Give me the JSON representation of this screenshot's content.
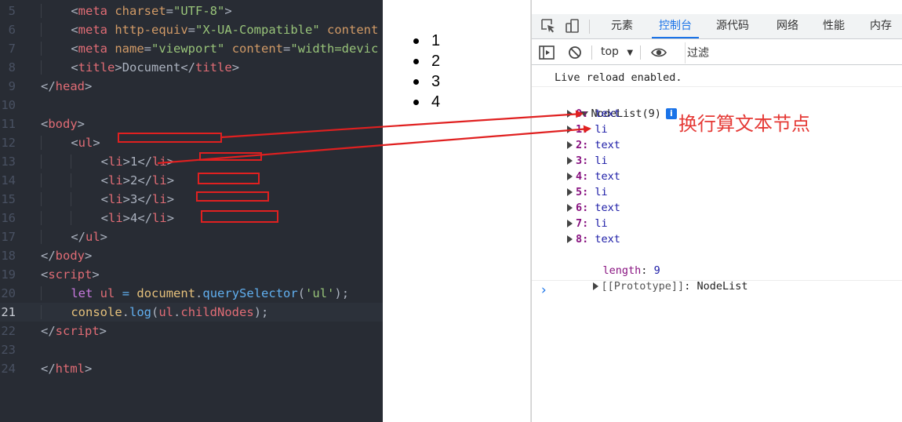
{
  "editor": {
    "lines": [
      {
        "num": "5",
        "indent": 1,
        "tokens": [
          [
            "t-pun",
            "<"
          ],
          [
            "t-tag",
            "meta"
          ],
          [
            "t-txt",
            " "
          ],
          [
            "t-attr",
            "charset"
          ],
          [
            "t-pun",
            "="
          ],
          [
            "t-str",
            "\"UTF-8\""
          ],
          [
            "t-pun",
            ">"
          ]
        ]
      },
      {
        "num": "6",
        "indent": 1,
        "tokens": [
          [
            "t-pun",
            "<"
          ],
          [
            "t-tag",
            "meta"
          ],
          [
            "t-txt",
            " "
          ],
          [
            "t-attr",
            "http-equiv"
          ],
          [
            "t-pun",
            "="
          ],
          [
            "t-str",
            "\"X-UA-Compatible\""
          ],
          [
            "t-txt",
            " "
          ],
          [
            "t-attr",
            "content"
          ]
        ]
      },
      {
        "num": "7",
        "indent": 1,
        "tokens": [
          [
            "t-pun",
            "<"
          ],
          [
            "t-tag",
            "meta"
          ],
          [
            "t-txt",
            " "
          ],
          [
            "t-attr",
            "name"
          ],
          [
            "t-pun",
            "="
          ],
          [
            "t-str",
            "\"viewport\""
          ],
          [
            "t-txt",
            " "
          ],
          [
            "t-attr",
            "content"
          ],
          [
            "t-pun",
            "="
          ],
          [
            "t-str",
            "\"width=devic"
          ]
        ]
      },
      {
        "num": "8",
        "indent": 1,
        "tokens": [
          [
            "t-pun",
            "<"
          ],
          [
            "t-tag",
            "title"
          ],
          [
            "t-pun",
            ">"
          ],
          [
            "t-txt",
            "Document"
          ],
          [
            "t-pun",
            "</"
          ],
          [
            "t-tag",
            "title"
          ],
          [
            "t-pun",
            ">"
          ]
        ]
      },
      {
        "num": "9",
        "indent": 0,
        "tokens": [
          [
            "t-pun",
            "</"
          ],
          [
            "t-tag",
            "head"
          ],
          [
            "t-pun",
            ">"
          ]
        ]
      },
      {
        "num": "10",
        "indent": 0,
        "tokens": []
      },
      {
        "num": "11",
        "indent": 0,
        "tokens": [
          [
            "t-pun",
            "<"
          ],
          [
            "t-tag",
            "body"
          ],
          [
            "t-pun",
            ">"
          ]
        ]
      },
      {
        "num": "12",
        "indent": 1,
        "tokens": [
          [
            "t-pun",
            "<"
          ],
          [
            "t-tag",
            "ul"
          ],
          [
            "t-pun",
            ">"
          ]
        ]
      },
      {
        "num": "13",
        "indent": 2,
        "tokens": [
          [
            "t-pun",
            "<"
          ],
          [
            "t-tag",
            "li"
          ],
          [
            "t-pun",
            ">"
          ],
          [
            "t-txt",
            "1"
          ],
          [
            "t-pun",
            "</"
          ],
          [
            "t-tag",
            "li"
          ],
          [
            "t-pun",
            ">"
          ]
        ]
      },
      {
        "num": "14",
        "indent": 2,
        "tokens": [
          [
            "t-pun",
            "<"
          ],
          [
            "t-tag",
            "li"
          ],
          [
            "t-pun",
            ">"
          ],
          [
            "t-txt",
            "2"
          ],
          [
            "t-pun",
            "</"
          ],
          [
            "t-tag",
            "li"
          ],
          [
            "t-pun",
            ">"
          ]
        ]
      },
      {
        "num": "15",
        "indent": 2,
        "tokens": [
          [
            "t-pun",
            "<"
          ],
          [
            "t-tag",
            "li"
          ],
          [
            "t-pun",
            ">"
          ],
          [
            "t-txt",
            "3"
          ],
          [
            "t-pun",
            "</"
          ],
          [
            "t-tag",
            "li"
          ],
          [
            "t-pun",
            ">"
          ]
        ]
      },
      {
        "num": "16",
        "indent": 2,
        "tokens": [
          [
            "t-pun",
            "<"
          ],
          [
            "t-tag",
            "li"
          ],
          [
            "t-pun",
            ">"
          ],
          [
            "t-txt",
            "4"
          ],
          [
            "t-pun",
            "</"
          ],
          [
            "t-tag",
            "li"
          ],
          [
            "t-pun",
            ">"
          ]
        ]
      },
      {
        "num": "17",
        "indent": 1,
        "tokens": [
          [
            "t-pun",
            "</"
          ],
          [
            "t-tag",
            "ul"
          ],
          [
            "t-pun",
            ">"
          ]
        ]
      },
      {
        "num": "18",
        "indent": 0,
        "tokens": [
          [
            "t-pun",
            "</"
          ],
          [
            "t-tag",
            "body"
          ],
          [
            "t-pun",
            ">"
          ]
        ]
      },
      {
        "num": "19",
        "indent": 0,
        "tokens": [
          [
            "t-pun",
            "<"
          ],
          [
            "t-tag",
            "script"
          ],
          [
            "t-pun",
            ">"
          ]
        ]
      },
      {
        "num": "20",
        "indent": 1,
        "tokens": [
          [
            "t-kw",
            "let"
          ],
          [
            "t-txt",
            " "
          ],
          [
            "t-var",
            "ul"
          ],
          [
            "t-txt",
            " "
          ],
          [
            "t-fn",
            "="
          ],
          [
            "t-txt",
            " "
          ],
          [
            "t-obj",
            "document"
          ],
          [
            "t-pun",
            "."
          ],
          [
            "t-fn",
            "querySelector"
          ],
          [
            "t-pun",
            "("
          ],
          [
            "t-str",
            "'ul'"
          ],
          [
            "t-pun",
            ");"
          ]
        ]
      },
      {
        "num": "21",
        "indent": 1,
        "active": true,
        "tokens": [
          [
            "t-obj",
            "console"
          ],
          [
            "t-pun",
            "."
          ],
          [
            "t-fn",
            "log"
          ],
          [
            "t-pun",
            "("
          ],
          [
            "t-var",
            "ul"
          ],
          [
            "t-pun",
            "."
          ],
          [
            "t-var",
            "childNodes"
          ],
          [
            "t-pun",
            ");"
          ]
        ]
      },
      {
        "num": "22",
        "indent": 0,
        "tokens": [
          [
            "t-pun",
            "</"
          ],
          [
            "t-tag",
            "script"
          ],
          [
            "t-pun",
            ">"
          ]
        ]
      },
      {
        "num": "23",
        "indent": 0,
        "tokens": []
      },
      {
        "num": "24",
        "indent": 0,
        "tokens": [
          [
            "t-pun",
            "</"
          ],
          [
            "t-tag",
            "html"
          ],
          [
            "t-pun",
            ">"
          ]
        ]
      }
    ]
  },
  "page": {
    "list_items": [
      "1",
      "2",
      "3",
      "4"
    ]
  },
  "devtools": {
    "tabs": [
      {
        "label": "元素",
        "active": false
      },
      {
        "label": "控制台",
        "active": true
      },
      {
        "label": "源代码",
        "active": false
      },
      {
        "label": "网络",
        "active": false
      },
      {
        "label": "性能",
        "active": false
      },
      {
        "label": "内存",
        "active": false
      }
    ],
    "toolbar": {
      "context": "top",
      "filter_placeholder": "过滤"
    },
    "console": {
      "message": "Live reload enabled.",
      "nodelist_label": "NodeList(9)",
      "info_badge": "i",
      "entries": [
        {
          "key": "0",
          "value": "text"
        },
        {
          "key": "1",
          "value": "li"
        },
        {
          "key": "2",
          "value": "text"
        },
        {
          "key": "3",
          "value": "li"
        },
        {
          "key": "4",
          "value": "text"
        },
        {
          "key": "5",
          "value": "li"
        },
        {
          "key": "6",
          "value": "text"
        },
        {
          "key": "7",
          "value": "li"
        },
        {
          "key": "8",
          "value": "text"
        }
      ],
      "length_key": "length",
      "length_value": "9",
      "prototype_key": "[[Prototype]]",
      "prototype_value": "NodeList",
      "prompt": "›"
    }
  },
  "annotation": {
    "text": "换行算文本节点",
    "color": "#e53935"
  }
}
